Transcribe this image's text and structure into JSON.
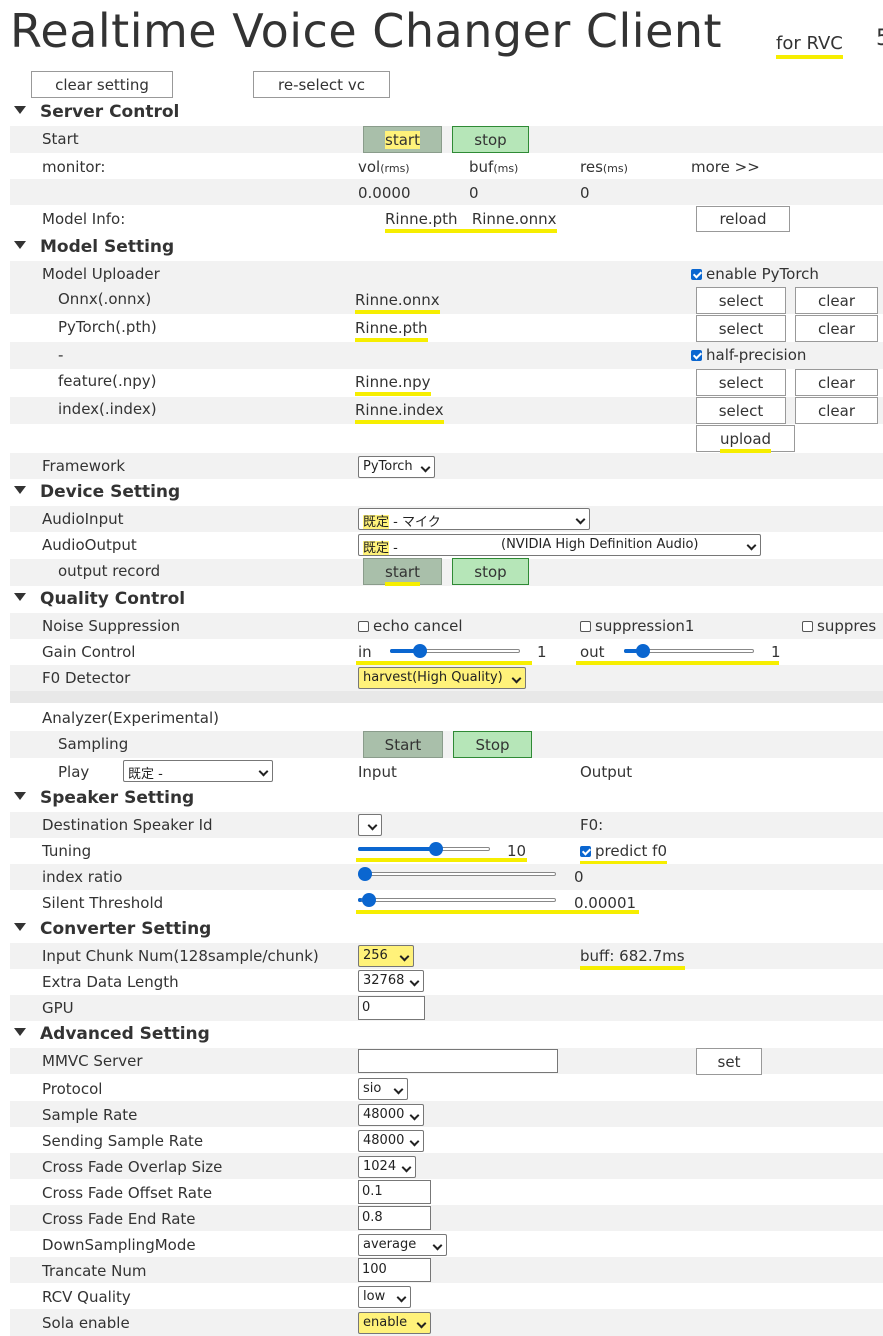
{
  "header": {
    "title": "Realtime Voice Changer Client",
    "subtitle": "for RVC",
    "cutoff_char": "5"
  },
  "top_buttons": {
    "clear_setting": "clear setting",
    "reselect_vc": "re-select vc"
  },
  "server_control": {
    "heading": "Server Control",
    "start_label": "Start",
    "start_button": "start",
    "stop_button": "stop",
    "monitor_label": "monitor:",
    "vol_label": "vol",
    "vol_unit": "(rms)",
    "buf_label": "buf",
    "buf_unit": "(ms)",
    "res_label": "res",
    "res_unit": "(ms)",
    "more_link": "more >>",
    "vol_value": "0.0000",
    "buf_value": "0",
    "res_value": "0",
    "model_info_label": "Model Info:",
    "model_info_pth": "Rinne.pth",
    "model_info_onnx": "Rinne.onnx",
    "reload_button": "reload"
  },
  "model_setting": {
    "heading": "Model Setting",
    "uploader_label": "Model Uploader",
    "enable_pytorch": "enable PyTorch",
    "onnx_label": "Onnx(.onnx)",
    "onnx_file": "Rinne.onnx",
    "pytorch_label": "PyTorch(.pth)",
    "pytorch_file": "Rinne.pth",
    "dash_label": "-",
    "half_precision": "half-precision",
    "feature_label": "feature(.npy)",
    "feature_file": "Rinne.npy",
    "index_label": "index(.index)",
    "index_file": "Rinne.index",
    "select_button": "select",
    "clear_button": "clear",
    "upload_button": "upload",
    "framework_label": "Framework",
    "framework_value": "PyTorch"
  },
  "device_setting": {
    "heading": "Device Setting",
    "audio_input_label": "AudioInput",
    "audio_input_prefix": "既定",
    "audio_input_value": " - マイク",
    "audio_output_label": "AudioOutput",
    "audio_output_prefix": "既定",
    "audio_output_dash": " -",
    "audio_output_value": "(NVIDIA High Definition Audio)",
    "output_record_label": "output record",
    "start_button": "start",
    "stop_button": "stop"
  },
  "quality_control": {
    "heading": "Quality Control",
    "noise_label": "Noise Suppression",
    "echo_cancel": "echo cancel",
    "suppression1": "suppression1",
    "suppression2": "suppres",
    "gain_label": "Gain Control",
    "gain_in_label": "in",
    "gain_in_value": "1",
    "gain_in_fraction": 0.2,
    "gain_out_label": "out",
    "gain_out_value": "1",
    "gain_out_fraction": 0.1,
    "f0_label": "F0 Detector",
    "f0_value": "harvest(High Quality)",
    "analyzer_label": "Analyzer(Experimental)",
    "sampling_label": "Sampling",
    "start_button": "Start",
    "stop_button": "Stop",
    "play_label": "Play",
    "play_value": "既定 -",
    "input_label": "Input",
    "output_label": "Output"
  },
  "speaker_setting": {
    "heading": "Speaker Setting",
    "dest_label": "Destination Speaker Id",
    "dest_value": "",
    "f0_label": "F0:",
    "tuning_label": "Tuning",
    "tuning_value": "10",
    "tuning_fraction": 0.6,
    "predict_f0": "predict f0",
    "index_ratio_label": "index ratio",
    "index_ratio_value": "0",
    "index_ratio_fraction": 0.0,
    "silent_label": "Silent Threshold",
    "silent_value": "0.00001",
    "silent_fraction": 0.02
  },
  "converter_setting": {
    "heading": "Converter Setting",
    "chunk_label": "Input Chunk Num(128sample/chunk)",
    "chunk_value": "256",
    "buff_text": "buff: 682.7ms",
    "extra_label": "Extra Data Length",
    "extra_value": "32768",
    "gpu_label": "GPU",
    "gpu_value": "0"
  },
  "advanced_setting": {
    "heading": "Advanced Setting",
    "mmvc_label": "MMVC Server",
    "mmvc_value": "",
    "set_button": "set",
    "protocol_label": "Protocol",
    "protocol_value": "sio",
    "sample_rate_label": "Sample Rate",
    "sample_rate_value": "48000",
    "sending_rate_label": "Sending Sample Rate",
    "sending_rate_value": "48000",
    "overlap_label": "Cross Fade Overlap Size",
    "overlap_value": "1024",
    "offset_label": "Cross Fade Offset Rate",
    "offset_value": "0.1",
    "end_label": "Cross Fade End Rate",
    "end_value": "0.8",
    "downsampling_label": "DownSamplingMode",
    "downsampling_value": "average",
    "trancate_label": "Trancate Num",
    "trancate_value": "100",
    "rcv_label": "RCV Quality",
    "rcv_value": "low",
    "sola_label": "Sola enable",
    "sola_value": "enable"
  },
  "colors": {
    "highlight": "#fff27a",
    "accent": "#0a66d0",
    "green_button": "#b6e6b8",
    "grey_button": "#a9bfaa"
  }
}
